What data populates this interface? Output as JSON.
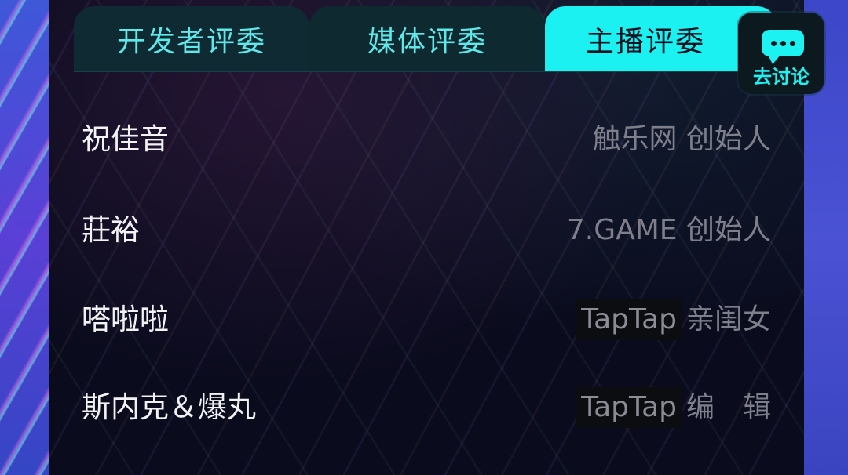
{
  "tabs": [
    {
      "label": "开发者评委",
      "active": false
    },
    {
      "label": "媒体评委",
      "active": false
    },
    {
      "label": "主播评委",
      "active": true
    }
  ],
  "discuss_button": {
    "label": "去讨论",
    "icon": "chat-bubble-icon"
  },
  "judges": [
    {
      "name": "祝佳音",
      "org": "",
      "role": "触乐网 创始人"
    },
    {
      "name": "莊裕",
      "org": "",
      "role": "7.GAME 创始人"
    },
    {
      "name": "嗒啦啦",
      "org": "TapTap",
      "role": "亲闺女"
    },
    {
      "name": "斯内克＆爆丸",
      "org": "TapTap",
      "role": "编　辑"
    }
  ],
  "colors": {
    "accent": "#1cf1f2",
    "tab_inactive_bg": "#0f2a33",
    "panel_bg": "#0a0b1d",
    "name_text": "#f2f2f4",
    "role_text": "#7e7f8a"
  }
}
